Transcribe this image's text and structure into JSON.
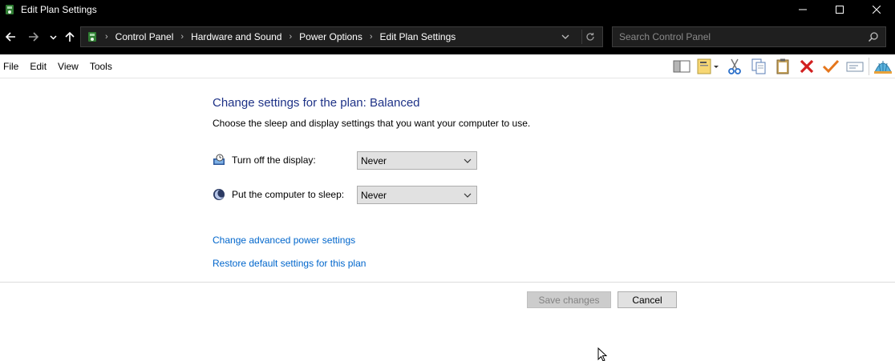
{
  "window": {
    "title": "Edit Plan Settings",
    "app_icon": "power-options-icon"
  },
  "nav": {
    "back_icon": "arrow-left-icon",
    "forward_icon": "arrow-right-icon",
    "recent_icon": "chevron-down-icon",
    "up_icon": "arrow-up-icon",
    "breadcrumbs": [
      "Control Panel",
      "Hardware and Sound",
      "Power Options",
      "Edit Plan Settings"
    ]
  },
  "search": {
    "placeholder": "Search Control Panel"
  },
  "menu": {
    "items": [
      "File",
      "Edit",
      "View",
      "Tools"
    ]
  },
  "content": {
    "heading": "Change settings for the plan: Balanced",
    "subtext": "Choose the sleep and display settings that you want your computer to use.",
    "settings": [
      {
        "label": "Turn off the display:",
        "value": "Never",
        "icon": "display-timer-icon"
      },
      {
        "label": "Put the computer to sleep:",
        "value": "Never",
        "icon": "moon-icon"
      }
    ],
    "links": [
      "Change advanced power settings",
      "Restore default settings for this plan"
    ]
  },
  "buttons": {
    "save": "Save changes",
    "cancel": "Cancel"
  },
  "colors": {
    "heading": "#1e3287",
    "link": "#0066cc",
    "titlebar": "#000000"
  }
}
